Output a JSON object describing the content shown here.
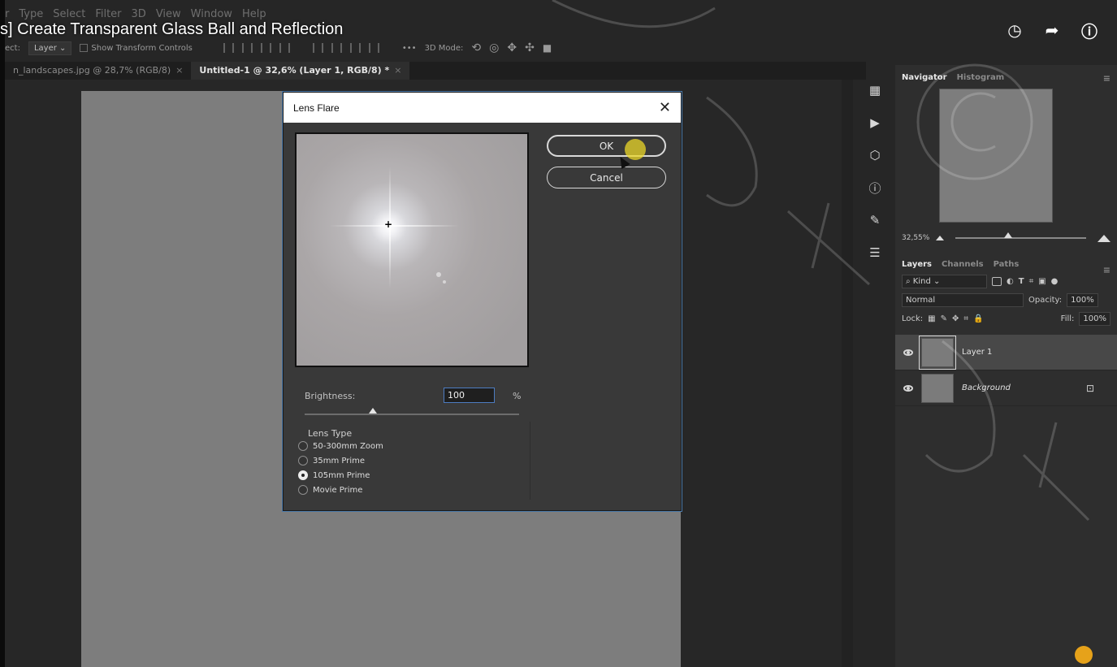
{
  "video": {
    "title": "s] Create Transparent Glass Ball and Reflection"
  },
  "menu": [
    "r",
    "Type",
    "Select",
    "Filter",
    "3D",
    "View",
    "Window",
    "Help"
  ],
  "options_bar": {
    "select_label": "ect:",
    "select_value": "Layer",
    "show_transform_controls": "Show Transform Controls",
    "more": "•••",
    "mode_label": "3D Mode:"
  },
  "tabs": [
    {
      "label": "n_landscapes.jpg @ 28,7% (RGB/8)",
      "close": "×",
      "active": false
    },
    {
      "label": "Untitled-1 @ 32,6% (Layer 1, RGB/8) *",
      "close": "×",
      "active": true
    }
  ],
  "dialog": {
    "title": "Lens Flare",
    "close": "✕",
    "ok_label": "OK",
    "cancel_label": "Cancel",
    "brightness_label": "Brightness:",
    "brightness_value": "100",
    "brightness_unit": "%",
    "brightness_slider": 0.32,
    "lens_type_title": "Lens Type",
    "lens_types": [
      {
        "label": "50-300mm Zoom",
        "checked": false
      },
      {
        "label": "35mm Prime",
        "checked": false
      },
      {
        "label": "105mm Prime",
        "checked": true
      },
      {
        "label": "Movie Prime",
        "checked": false
      }
    ]
  },
  "navigator": {
    "tabs": [
      "Navigator",
      "Histogram"
    ],
    "zoom": "32,55%",
    "menu": "≡"
  },
  "layers_panel": {
    "tabs": [
      "Layers",
      "Channels",
      "Paths"
    ],
    "kind": "Kind",
    "blend_mode": "Normal",
    "opacity_label": "Opacity:",
    "opacity_value": "100%",
    "lock_label": "Lock:",
    "fill_label": "Fill:",
    "fill_value": "100%",
    "layers": [
      {
        "name": "Layer 1",
        "selected": true,
        "italic": false,
        "locked": false
      },
      {
        "name": "Background",
        "selected": false,
        "italic": true,
        "locked": true
      }
    ]
  },
  "colors": {
    "dialog_bg": "#393939",
    "canvas_gray": "#7d7d7d",
    "focus_blue": "#4d7cc1",
    "cursor_highlight": "#ebd728"
  }
}
